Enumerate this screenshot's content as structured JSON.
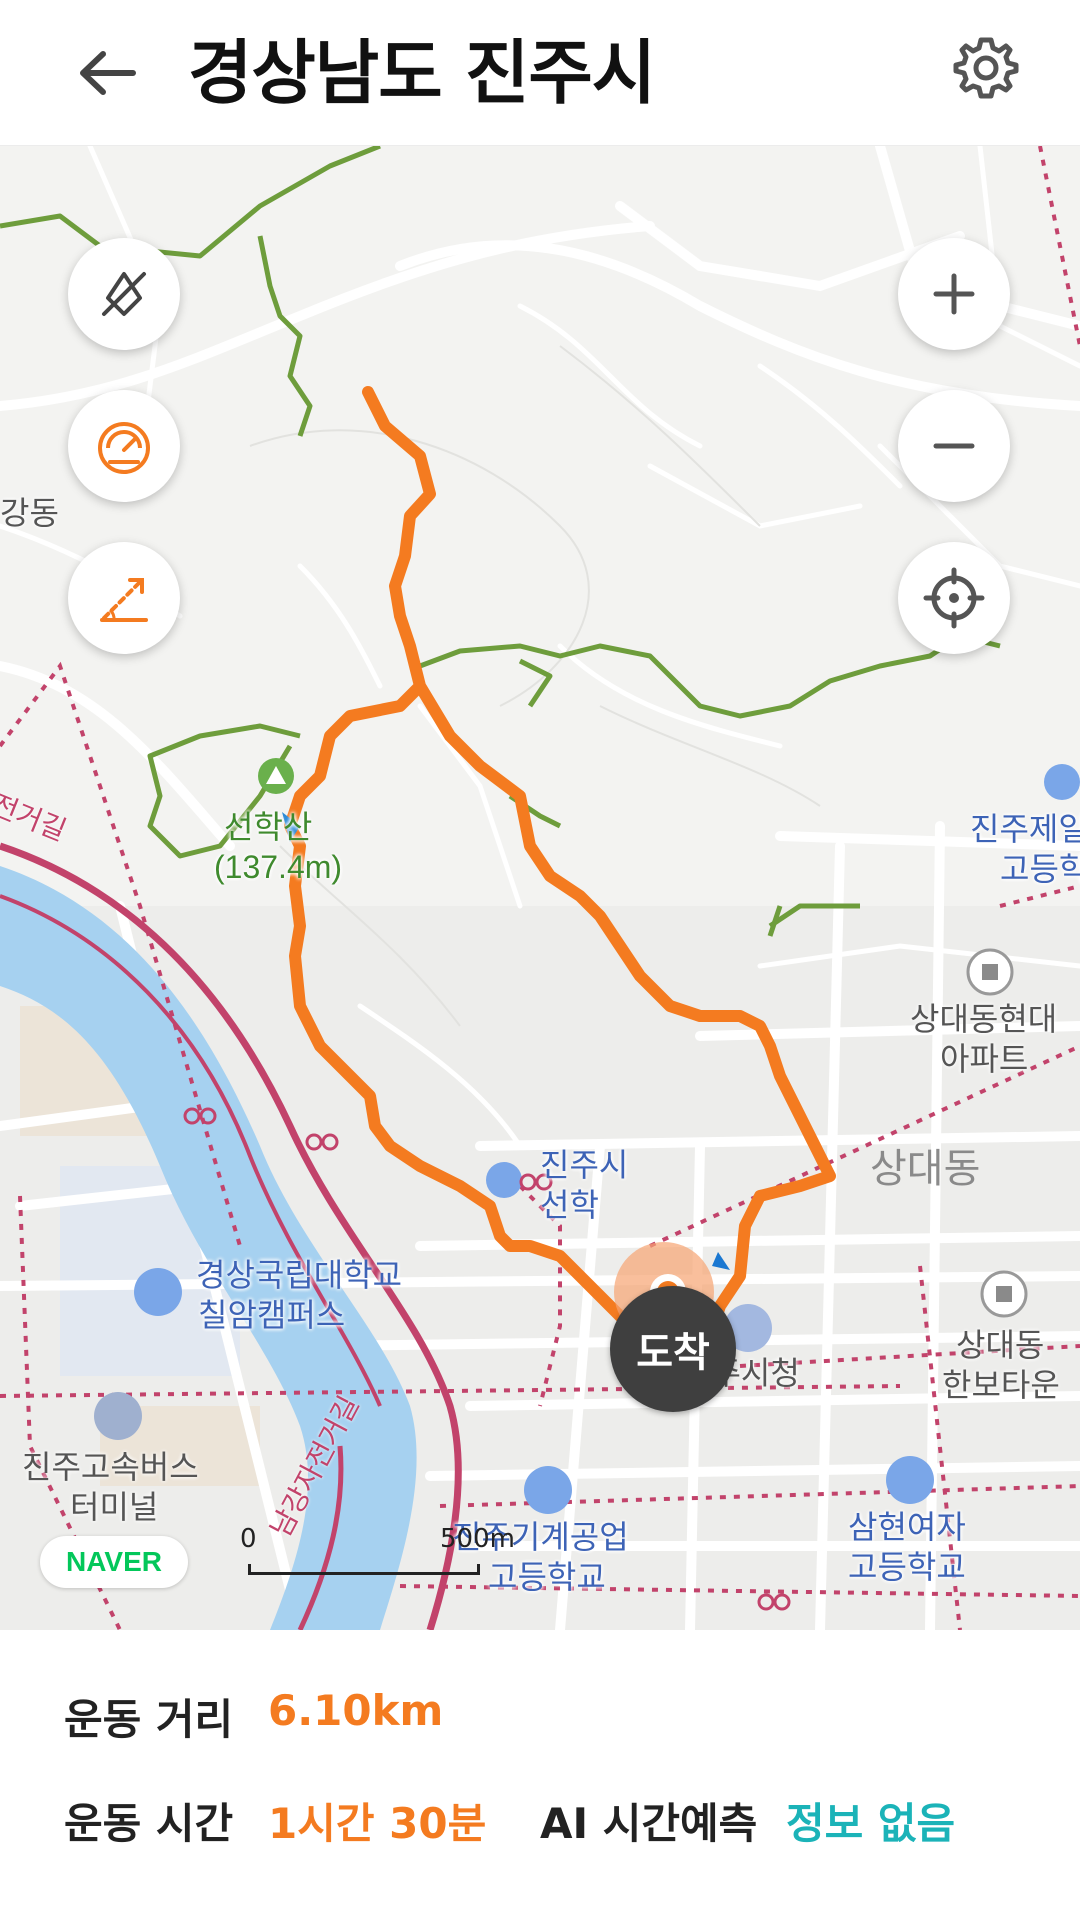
{
  "header": {
    "title": "경상남도 진주시"
  },
  "map": {
    "labels": {
      "dong_left": "강동",
      "mountain_name": "선학산",
      "mountain_height": "(137.4m)",
      "school1_line1": "진주제일",
      "school1_line2": "고등학",
      "apt1_line1": "상대동현대",
      "apt1_line2": "아파트",
      "sangdae": "상대동",
      "museum_line1": "진주시",
      "museum_line2": "선학",
      "univ_line1": "경상국립대학교",
      "univ_line2": "칠암캠퍼스",
      "cityhall": "진주시청",
      "apt2_line1": "상대동",
      "apt2_line2": "한보타운",
      "bus_line1": "진주고속버스",
      "bus_line2": "터미널",
      "school2_line1": "진주기계공업",
      "school2_line2": "고등학교",
      "school3_line1": "삼현여자",
      "school3_line2": "고등학교",
      "bike_road1": "남강자전거길",
      "bike_road2": "전거길"
    },
    "arrival_label": "도착",
    "provider": "NAVER",
    "scale": {
      "start": "0",
      "end": "500m"
    },
    "colors": {
      "route": "#f47b20",
      "trail": "#6e9d3c",
      "river": "#a6d1f0",
      "bike_road": "#c2436b"
    }
  },
  "controls": {
    "left": [
      "compass-off-icon",
      "speed-gauge-icon",
      "slope-icon"
    ],
    "right": [
      "zoom-in-icon",
      "zoom-out-icon",
      "my-location-icon"
    ]
  },
  "stats": {
    "distance_label": "운동 거리",
    "distance_value": "6.10km",
    "time_label": "운동 시간",
    "time_value": "1시간 30분",
    "ai_label": "AI 시간예측",
    "ai_value": "정보 없음"
  }
}
